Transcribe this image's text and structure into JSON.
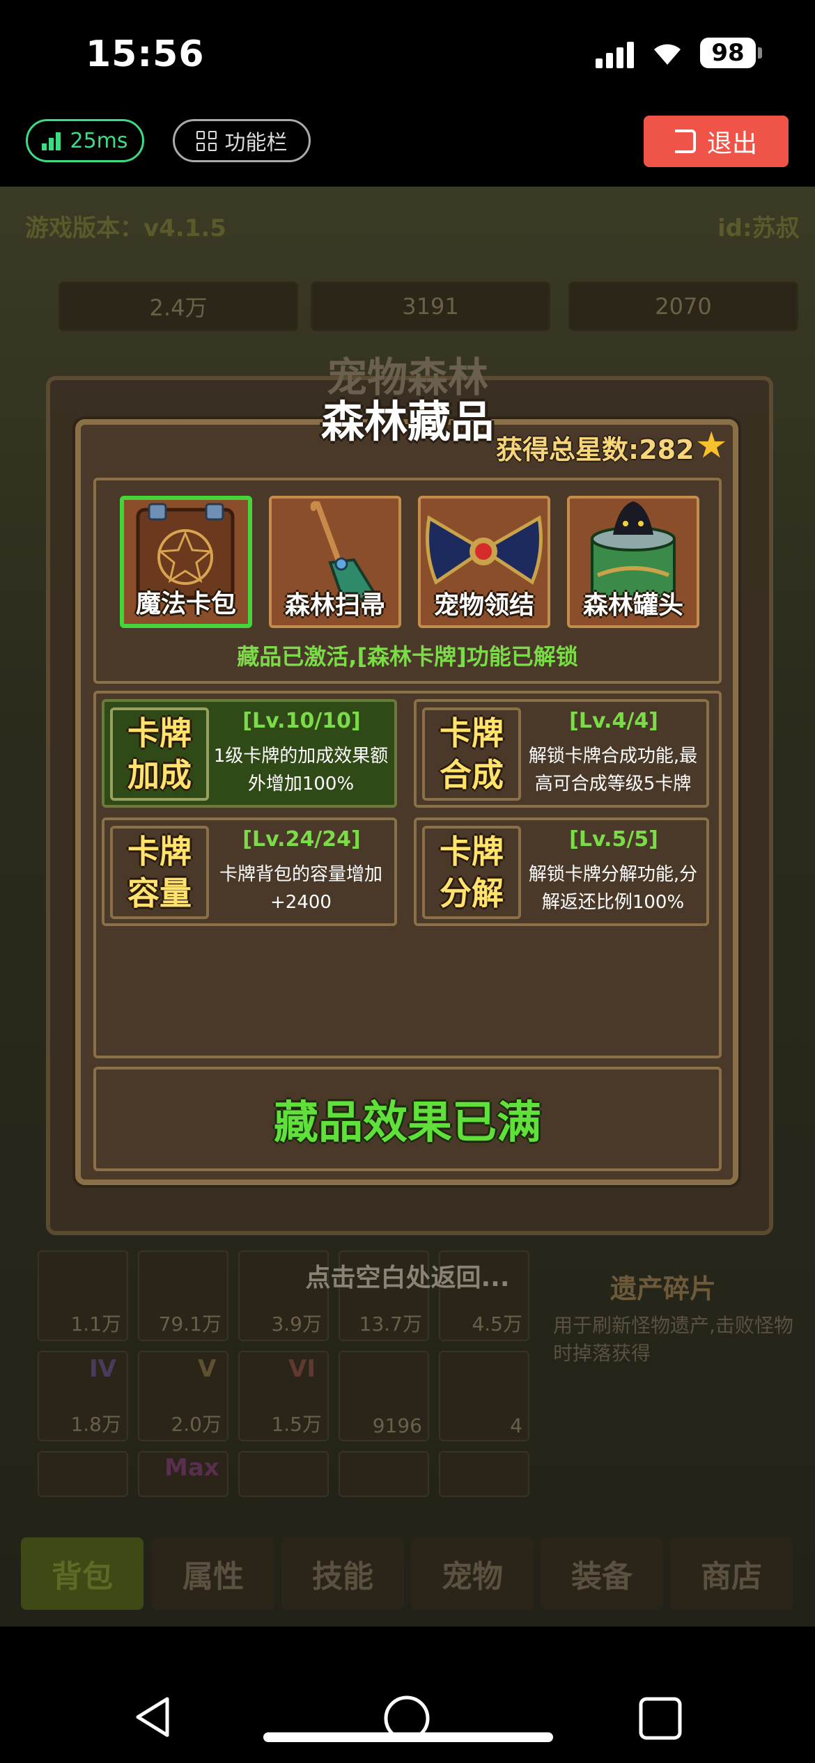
{
  "status_bar": {
    "time": "15:56",
    "battery": "98"
  },
  "top_bar": {
    "ping": "25ms",
    "function_bar": "功能栏",
    "exit": "退出"
  },
  "background": {
    "version": "游戏版本：v4.1.5",
    "id_label": "id:苏叔",
    "resources": [
      "2.4万",
      "3191",
      "2070"
    ],
    "relic_title": "遗产碎片",
    "relic_desc": "用于刷新怪物遗产,击败怪物时掉落获得",
    "inventory_counts": [
      "1.1万",
      "79.1万",
      "3.9万",
      "13.7万",
      "4.5万",
      "1.8万",
      "2.0万",
      "1.5万",
      "9196",
      "4"
    ],
    "inventory_marks": [
      "IV",
      "V",
      "VI",
      "Max"
    ],
    "tabs": [
      "背包",
      "属性",
      "技能",
      "宠物",
      "装备",
      "商店"
    ]
  },
  "modal": {
    "ghost_title": "宠物森林",
    "title": "森林藏品",
    "total_stars_label": "获得总星数:282",
    "items": [
      {
        "name": "魔法卡包",
        "selected": true
      },
      {
        "name": "森林扫帚",
        "selected": false
      },
      {
        "name": "宠物领结",
        "selected": false
      },
      {
        "name": "森林罐头",
        "selected": false
      }
    ],
    "activated_text": "藏品已激活,[森林卡牌]功能已解锁",
    "effects": [
      {
        "title_line1": "卡牌",
        "title_line2": "加成",
        "level": "[Lv.10/10]",
        "desc": "1级卡牌的加成效果额外增加100%",
        "highlight": true
      },
      {
        "title_line1": "卡牌",
        "title_line2": "合成",
        "level": "[Lv.4/4]",
        "desc": "解锁卡牌合成功能,最高可合成等级5卡牌",
        "highlight": false
      },
      {
        "title_line1": "卡牌",
        "title_line2": "容量",
        "level": "[Lv.24/24]",
        "desc": "卡牌背包的容量增加+2400",
        "highlight": false
      },
      {
        "title_line1": "卡牌",
        "title_line2": "分解",
        "level": "[Lv.5/5]",
        "desc": "解锁卡牌分解功能,分解返还比例100%",
        "highlight": false
      }
    ],
    "full_button": "藏品效果已满"
  },
  "tap_hint": "点击空白处返回..."
}
